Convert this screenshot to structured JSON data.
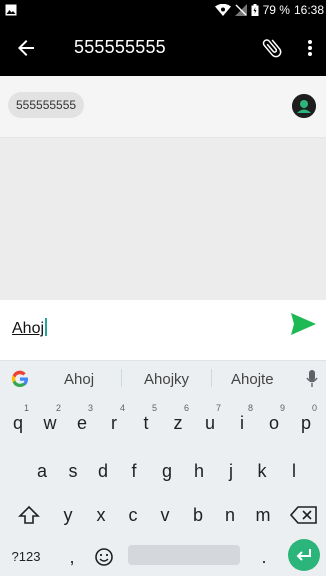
{
  "status_bar": {
    "battery": "79 %",
    "time": "16:38"
  },
  "app_bar": {
    "title": "555555555"
  },
  "recipients": {
    "chip": "555555555"
  },
  "compose": {
    "text": "Ahoj"
  },
  "keyboard": {
    "suggestions": [
      "Ahoj",
      "Ahojky",
      "Ahojte"
    ],
    "row1": [
      {
        "k": "q",
        "n": "1"
      },
      {
        "k": "w",
        "n": "2"
      },
      {
        "k": "e",
        "n": "3"
      },
      {
        "k": "r",
        "n": "4"
      },
      {
        "k": "t",
        "n": "5"
      },
      {
        "k": "z",
        "n": "6"
      },
      {
        "k": "u",
        "n": "7"
      },
      {
        "k": "i",
        "n": "8"
      },
      {
        "k": "o",
        "n": "9"
      },
      {
        "k": "p",
        "n": "0"
      }
    ],
    "row2": [
      "a",
      "s",
      "d",
      "f",
      "g",
      "h",
      "j",
      "k",
      "l"
    ],
    "row3": [
      "y",
      "x",
      "c",
      "v",
      "b",
      "n",
      "m"
    ],
    "symbols_key": "?123",
    "comma_key": ",",
    "period_key": "."
  },
  "colors": {
    "accent_green": "#2bb57b",
    "send_green": "#1db954"
  }
}
